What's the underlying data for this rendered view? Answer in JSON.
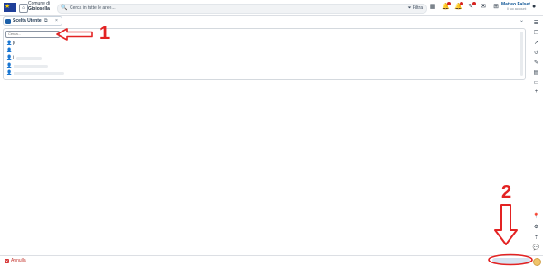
{
  "header": {
    "org_line1": "Comune di",
    "org_line2": "Gioiosella",
    "search_placeholder": "Cerca in tutte le aree...",
    "filter_label": "Filtra",
    "user_name": "Matteo Falset...",
    "user_subtitle": "Il tuo account"
  },
  "tab": {
    "label": "Scelta Utente"
  },
  "panel": {
    "search_placeholder": "Cerca...",
    "rows": [
      {
        "text": "p"
      },
      {
        "text": "................................ ."
      },
      {
        "text": "i"
      },
      {
        "text": ""
      },
      {
        "text": ""
      }
    ]
  },
  "annotations": {
    "one": "1",
    "two": "2"
  },
  "footer": {
    "cancel_label": "Annulla"
  },
  "colors": {
    "accent": "#1b5fa8",
    "danger": "#e32323"
  }
}
